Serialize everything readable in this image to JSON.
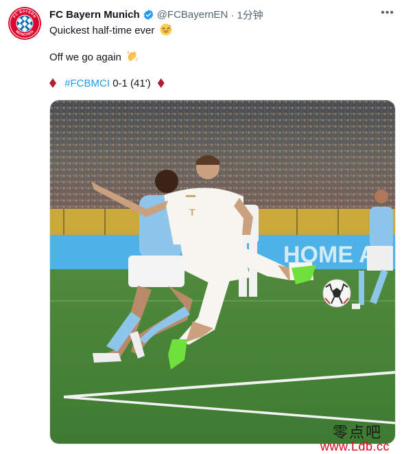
{
  "account": {
    "display_name": "FC Bayern Munich",
    "handle": "@FCBayernEN",
    "timestamp": "· 1分钟",
    "logo_text_top": "FC BAYERN",
    "logo_text_bottom": "MÜNCHEN"
  },
  "tweet": {
    "line1": "Quickest half-time ever",
    "line2": "Off we go again",
    "hashtag": "#FCBMCI",
    "score": "0-1 (41')"
  },
  "icons": {
    "verified": "verified-badge-icon",
    "more": "more-options-icon",
    "sweat_smile": "grinning-sweat-emoji",
    "clap": "clapping-hands-emoji",
    "diamond": "red-diamond-icon"
  },
  "watermark": {
    "chinese": "零点吧",
    "url": "www.Ldb.cc"
  },
  "colors": {
    "link": "#1d9bf0",
    "verified": "#1d9bf0",
    "diamond": "#b21f35",
    "bayern_red": "#dc052d",
    "watermark_url": "#e0001b"
  }
}
